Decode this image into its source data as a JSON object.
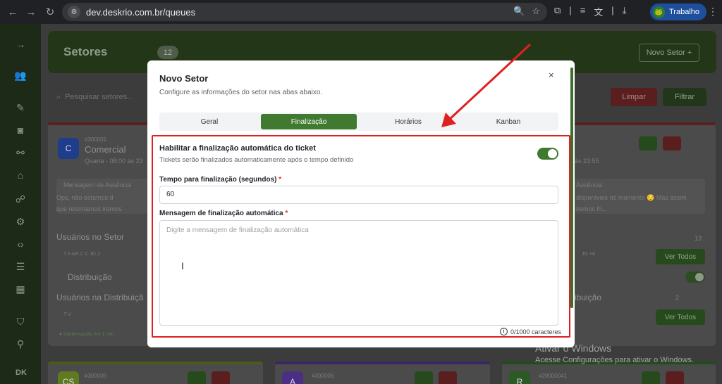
{
  "browser": {
    "url": "dev.deskrio.com.br/queues",
    "profile_label": "Trabalho",
    "profile_initial": "🐸"
  },
  "header": {
    "title": "Setores",
    "count": "12",
    "new_button": "Novo Setor +"
  },
  "toolbar": {
    "search_placeholder": "Pesquisar setores...",
    "clear_label": "Limpar",
    "filter_label": "Filtrar"
  },
  "sidebar": {
    "footer_label": "DK"
  },
  "cards": {
    "first": {
      "avatar": "C",
      "code": "#300001",
      "name": "Comercial",
      "hours": "Quarta - 08:00 às 23",
      "absence_title": "Mensagem de Ausência",
      "absence_text_1": "Ops, não estamos d",
      "absence_text_2": "que retornamos iremos",
      "users_title": "Usuários no Setor",
      "users_initials": "T  A  AR  C  C  JD  J",
      "distribution_title": "Distribuição",
      "distribution_users_title": "Usuários na Distribuiçã",
      "distribution_initials": "T  V",
      "status_tag": "● Ininterrupção em 1 min"
    },
    "right": {
      "hours": "às 23:55",
      "absence_title": "Ausência",
      "absence_text_1": "disponíveis no momento 😔 Mas assim",
      "absence_text_2": "iremos lh...",
      "users_count": "13",
      "users_initials": "JG  +8",
      "view_all": "Ver Todos",
      "distribution_label": "ibuição",
      "distribution_count": "2"
    },
    "bottom": [
      {
        "code": "#300005",
        "avatar": "CS"
      },
      {
        "code": "#300006",
        "avatar": "A"
      },
      {
        "code": "#20000041",
        "avatar": "R"
      }
    ]
  },
  "watermark": {
    "line1": "Ativar o Windows",
    "line2": "Acesse Configurações para ativar o Windows."
  },
  "modal": {
    "title": "Novo Setor",
    "subtitle": "Configure as informações do setor nas abas abaixo.",
    "close": "×",
    "tabs": [
      "Geral",
      "Finalização",
      "Horários",
      "Kanban"
    ],
    "active_tab": "Finalização",
    "auto_finish": {
      "title": "Habilitar a finalização automática do ticket",
      "description": "Tickets serão finalizados automaticamente após o tempo definido",
      "enabled": true
    },
    "time_field": {
      "label": "Tempo para finalização (segundos)",
      "required_mark": "*",
      "value": "60"
    },
    "message_field": {
      "label": "Mensagem de finalização automática",
      "required_mark": "*",
      "placeholder": "Digite a mensagem de finalização automática",
      "value": ""
    },
    "counter": "0/1000 caracteres"
  },
  "colors": {
    "brand_green": "#3f7a30",
    "highlight_red": "#e02020"
  }
}
